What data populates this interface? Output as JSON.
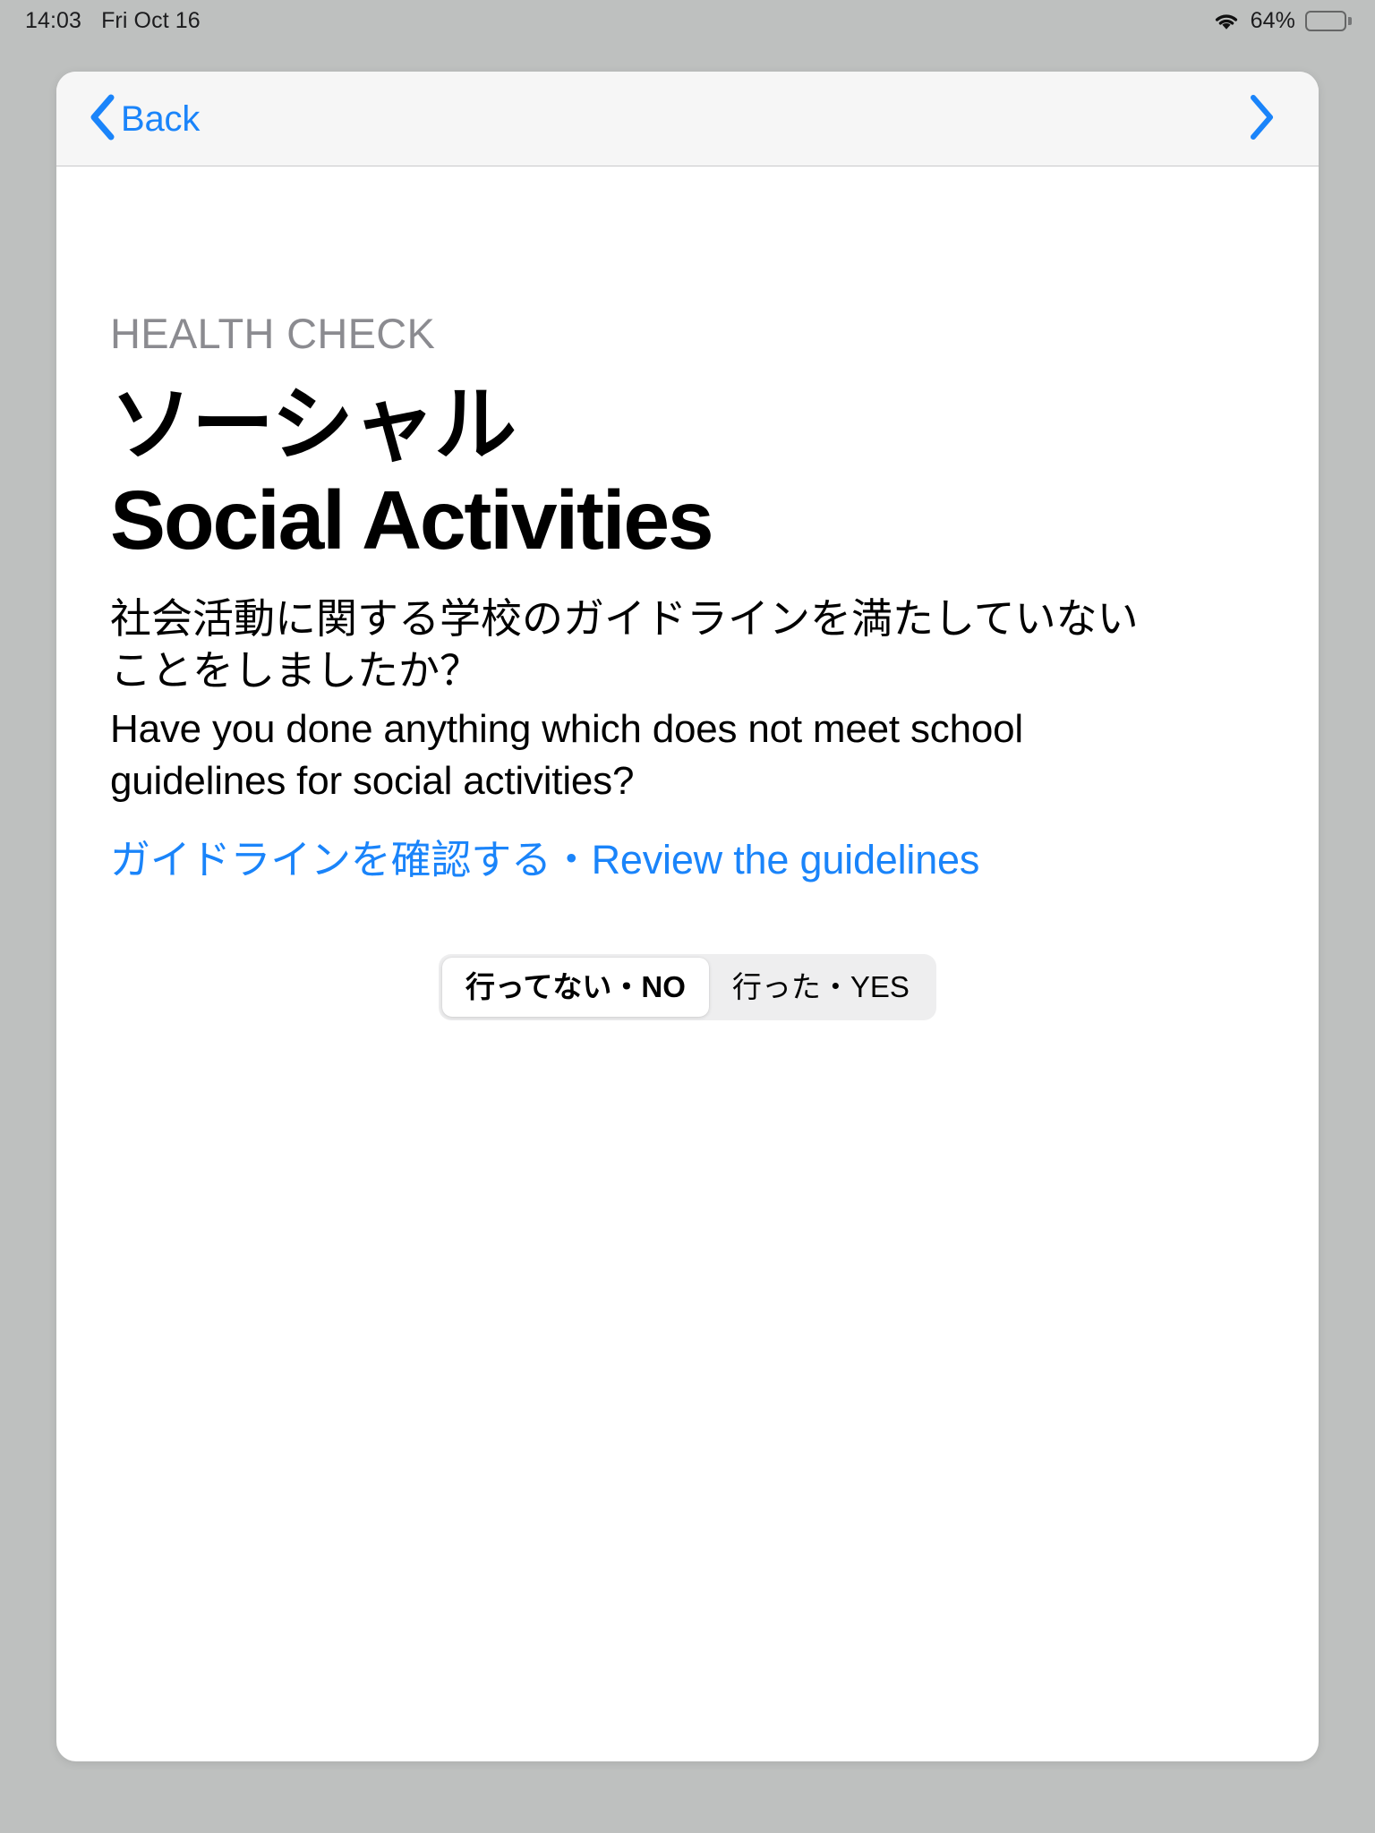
{
  "status_bar": {
    "time": "14:03",
    "date": "Fri Oct 16",
    "wifi_icon": "wifi-icon",
    "battery_percent": "64%",
    "battery_level": 64
  },
  "nav_bar": {
    "back_label": "Back",
    "back_icon": "chevron-left-icon",
    "forward_icon": "chevron-right-icon"
  },
  "content": {
    "eyebrow": "HEALTH CHECK",
    "title_ja": "ソーシャル",
    "title_en": "Social Activities",
    "question_ja": "社会活動に関する学校のガイドラインを満たしていないことをしましたか？",
    "question_en": "Have you done anything which does not meet school guidelines for social activities?",
    "link_label": "ガイドラインを確認する・Review the guidelines"
  },
  "answer_control": {
    "options": [
      {
        "label": "行ってない・NO",
        "selected": true
      },
      {
        "label": "行った・YES",
        "selected": false
      }
    ],
    "selected_index": 0
  },
  "colors": {
    "accent_blue": "#1a84fa",
    "eyebrow_gray": "#8b8b90",
    "page_background": "#bec0bf",
    "card_background": "#ffffff",
    "nav_background": "#f6f6f6",
    "segment_track": "#eeeeef"
  }
}
